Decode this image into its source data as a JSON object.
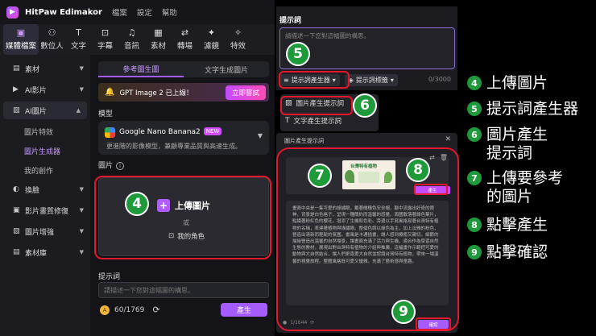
{
  "app": {
    "name": "HitPaw Edimakor",
    "menu": [
      "檔案",
      "設定",
      "幫助"
    ]
  },
  "toolbar": [
    {
      "icon": "media-icon",
      "glyph": "▣",
      "label": "媒體檔案"
    },
    {
      "icon": "avatar-icon",
      "glyph": "⚇",
      "label": "數位人"
    },
    {
      "icon": "text-icon",
      "glyph": "T",
      "label": "文字"
    },
    {
      "icon": "caption-icon",
      "glyph": "⊡",
      "label": "字幕"
    },
    {
      "icon": "music-icon",
      "glyph": "♫",
      "label": "音訊"
    },
    {
      "icon": "material-icon",
      "glyph": "▦",
      "label": "素材"
    },
    {
      "icon": "transition-icon",
      "glyph": "⇄",
      "label": "轉場"
    },
    {
      "icon": "filter-icon",
      "glyph": "✦",
      "label": "濾鏡"
    },
    {
      "icon": "effect-icon",
      "glyph": "✧",
      "label": "特效"
    }
  ],
  "sidebar": {
    "items": [
      {
        "icon": "material-icon",
        "glyph": "▤",
        "label": "素材"
      },
      {
        "icon": "ai-video-icon",
        "glyph": "▶",
        "label": "AI影片"
      },
      {
        "icon": "ai-image-icon",
        "glyph": "▨",
        "label": "AI圖片"
      }
    ],
    "sub": [
      "圖片特效",
      "圖片生成器",
      "我的創作"
    ],
    "items2": [
      {
        "icon": "face-swap-icon",
        "glyph": "◐",
        "label": "換臉"
      },
      {
        "icon": "video-repair-icon",
        "glyph": "▣",
        "label": "影片畫質修復"
      },
      {
        "icon": "image-enhance-icon",
        "glyph": "▧",
        "label": "圖片增強"
      },
      {
        "icon": "material-library-icon",
        "glyph": "▤",
        "label": "素材庫"
      }
    ]
  },
  "main": {
    "tabs": [
      "參考圖生圖",
      "文字生成圖片"
    ],
    "banner_text": "GPT Image 2 已上線！",
    "banner_button": "立即嘗試",
    "model_label": "模型",
    "model_name": "Google Nano Banana2",
    "model_badge": "NEW",
    "model_desc": "更進階的影像模型，兼顧專業品質與高速生成。",
    "image_label": "圖片",
    "upload_label": "上傳圖片",
    "or_label": "或",
    "my_character": "我的角色",
    "prompt_label": "提示詞",
    "prompt_placeholder": "請描述一下您對這幅圖的構思。",
    "credits": "60/1769",
    "generate": "產生"
  },
  "prompt_panel": {
    "title": "提示詞",
    "placeholder": "請描述一下您對這幅圖的構思。",
    "btn_generator": "提示詞產生器",
    "btn_tags": "提示詞標籤",
    "count": "0/3000"
  },
  "dropdown": [
    "圖片產生提示詞",
    "文字產生提示詞"
  ],
  "dialog": {
    "title": "圖片產生提示詞",
    "thumb_title": "台灣特有植物",
    "gen_button": "產生",
    "text": "畫面中央是一隻可愛的綠繡眼，戴著橄欖色安全帽，腳中流露出好奇的眼神，背景是白色格子，呈現一種簡約而溫馨的感覺。周圍散落著綠色葉片，點綴著粉紅色的櫻花，增添了生機和色彩。旁邊以手寫風格寫著台灣特有植物的名稱，表達著植物與綠繡眼。整個色調以綠色為主，加上淡雅的粉色，營造出清新而輕鬆的氛圍。畫風是卡通插畫，讓人感到療癒又親切。細節的描繪營造出溫馨的自然場景，讓畫面充滿了活力與生機，適合作為學習自然生態的教材，展現出對台灣特有植物的介紹與推廣，這幅畫作示範把可愛的動物與大自然結合，讓人們更喜愛大自然並認識台灣特有植物，帶來一場溫馨的視覺旅程。整體風格既可愛又優雅，充滿了藝術感與童趣。",
    "footer": "1/1644",
    "ok": "確認"
  },
  "annotations": [
    "4",
    "5",
    "6",
    "7",
    "8",
    "9"
  ],
  "legend": [
    {
      "num": "4",
      "text": "上傳圖片"
    },
    {
      "num": "5",
      "text": "提示詞產生器"
    },
    {
      "num": "6",
      "text": "圖片產生\n提示詞"
    },
    {
      "num": "7",
      "text": "上傳要參考\n的圖片"
    },
    {
      "num": "8",
      "text": "點擊產生"
    },
    {
      "num": "9",
      "text": "點擊確認"
    }
  ],
  "colors": {
    "accent": "#a45cff",
    "annotation_red": "#e3182b",
    "badge_green": "#1e9a3a"
  }
}
